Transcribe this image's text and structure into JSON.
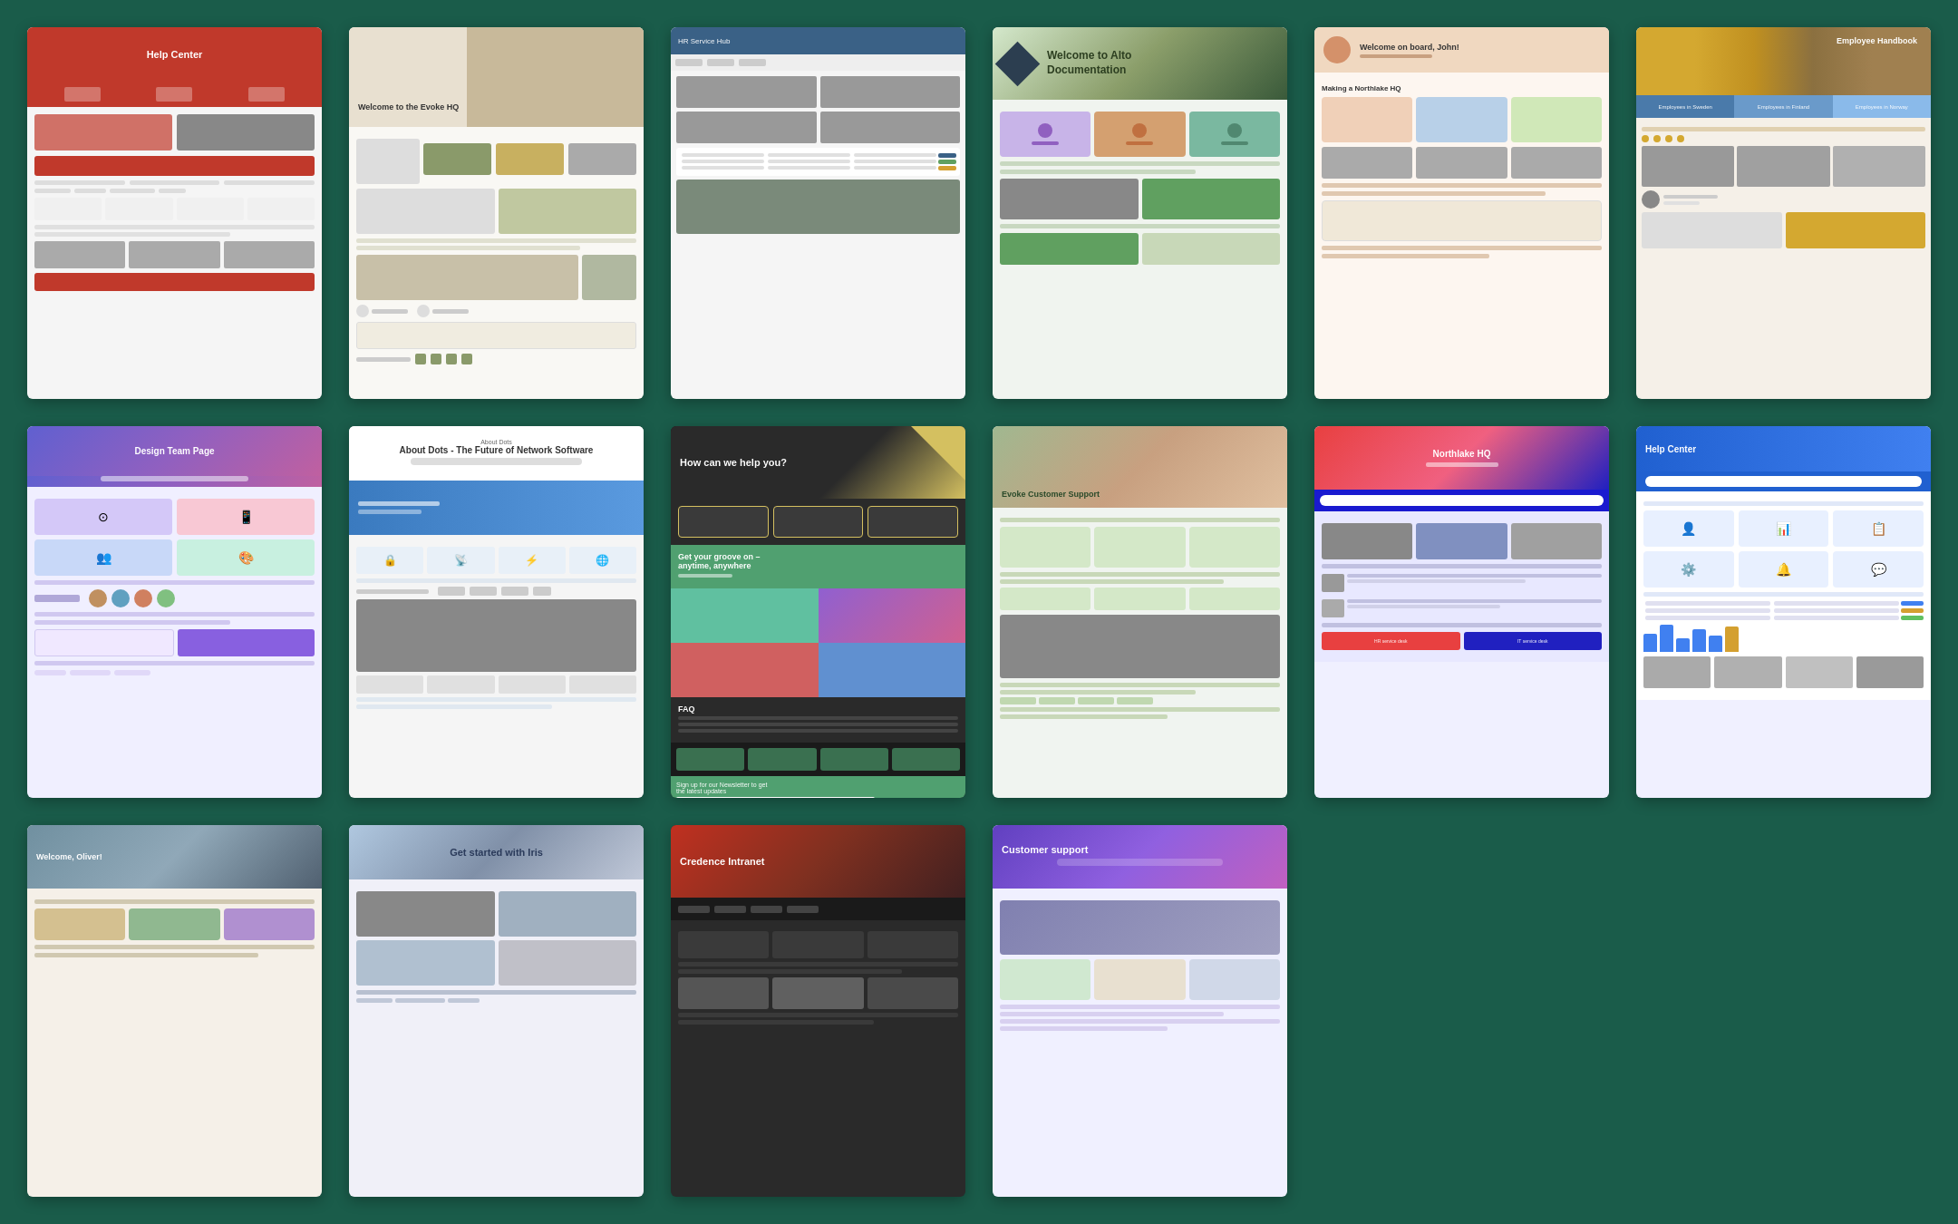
{
  "background_color": "#1a5c4a",
  "cards": [
    {
      "id": "card-1",
      "title": "Help Center",
      "type": "help-center-red",
      "color": "#c0392b"
    },
    {
      "id": "card-2",
      "title": "Welcome to the Evoke HQ",
      "type": "evoke-hq",
      "color": "#8a9a6a"
    },
    {
      "id": "card-3",
      "title": "HR Service Hub",
      "type": "hr-service",
      "color": "#3a6186"
    },
    {
      "id": "card-4",
      "title": "Welcome to Alto Documentation",
      "type": "alto-docs",
      "color": "#3a5a3a"
    },
    {
      "id": "card-5",
      "title": "Welcome on board, John!",
      "type": "onboarding",
      "color": "#d4916a"
    },
    {
      "id": "card-6",
      "title": "Employee Handbook",
      "type": "employee-handbook",
      "color": "#d4a830"
    },
    {
      "id": "card-7",
      "title": "Design Team Page",
      "type": "design-team",
      "color": "#9060c0"
    },
    {
      "id": "card-8",
      "title": "About Dots - The Future of Network Software",
      "type": "about-dots",
      "color": "#3a7abf"
    },
    {
      "id": "card-9",
      "title": "How can we help you?",
      "type": "help-colorful",
      "color": "#d4c060"
    },
    {
      "id": "card-10",
      "title": "Evoke Customer Support",
      "type": "customer-support-green",
      "color": "#4a8a4a"
    },
    {
      "id": "card-11",
      "title": "Northlake HQ",
      "type": "northlake-hq",
      "color": "#2020c0"
    },
    {
      "id": "card-12",
      "title": "Help Center",
      "type": "help-center-blue",
      "color": "#2060d0"
    },
    {
      "id": "card-13",
      "title": "Welcome, Oliver!",
      "type": "welcome-oliver",
      "color": "#7090a0"
    },
    {
      "id": "card-14",
      "title": "Get started with Iris",
      "type": "iris",
      "color": "#8090a8"
    },
    {
      "id": "card-15",
      "title": "Credence Intranet",
      "type": "credence-intranet",
      "color": "#c03020"
    },
    {
      "id": "card-16",
      "title": "Customer support",
      "type": "customer-support-purple",
      "color": "#6040c0"
    }
  ],
  "employees": {
    "sweden": "Employees in Sweden",
    "finland": "Employees in Finland",
    "norway": "Employees in Norway"
  },
  "credence": {
    "title": "Credence Intranet"
  },
  "employee_handbook": {
    "title": "Employee Handbook"
  }
}
